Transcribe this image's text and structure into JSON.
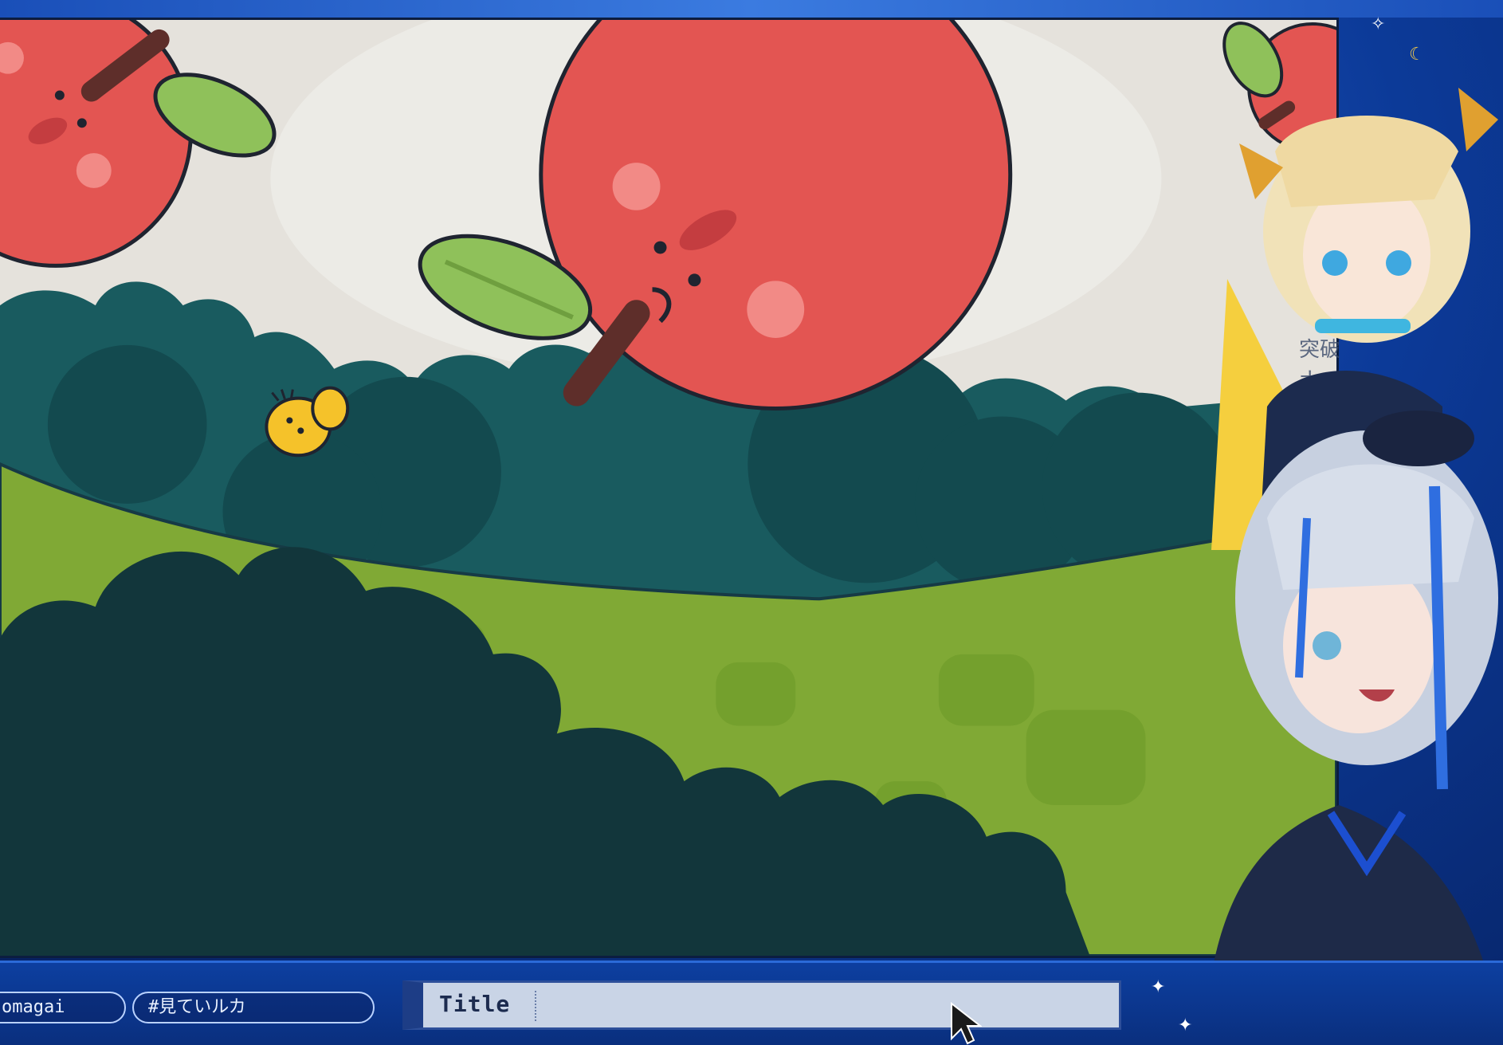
{
  "overlay_labels": {
    "partial_text_line1": "突破",
    "partial_text_line2": "ナ"
  },
  "bottom_bar": {
    "tags": [
      "omagai",
      "#見ていルカ"
    ],
    "title_label": "Title"
  },
  "colors": {
    "apple_red": "#e35552",
    "leaf_green": "#8fc15a",
    "forest_teal": "#195b5f",
    "grass_green": "#80a935",
    "dark_bush": "#12363b",
    "sky": "#e5e2dc",
    "bird_yellow": "#f5c22a",
    "frame_blue": "#0c3a98"
  }
}
